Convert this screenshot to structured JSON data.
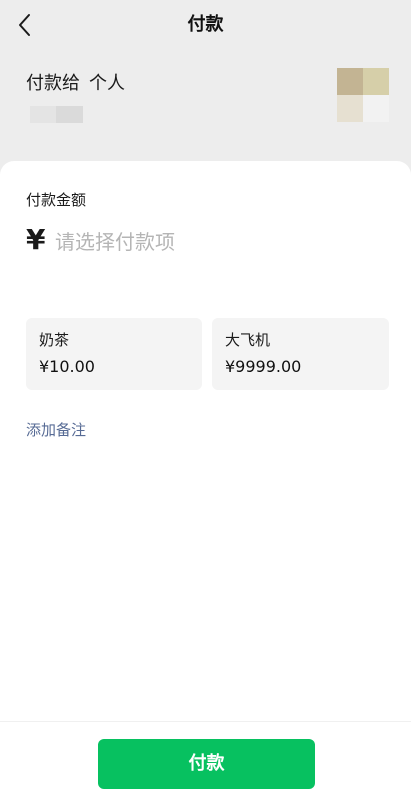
{
  "header": {
    "title": "付款",
    "back_icon": "chevron-left-icon"
  },
  "payee": {
    "prefix": "付款给",
    "name": "个人"
  },
  "amount": {
    "label": "付款金额",
    "currency": "¥",
    "placeholder": "请选择付款项",
    "value": ""
  },
  "options": [
    {
      "name": "奶茶",
      "price": "¥10.00"
    },
    {
      "name": "大飞机",
      "price": "¥9999.00"
    }
  ],
  "note_link": "添加备注",
  "pay_button": "付款",
  "colors": {
    "primary": "#07c160",
    "link": "#576b95",
    "page_bg": "#ededed",
    "card_bg": "#ffffff",
    "option_bg": "#f4f4f4",
    "placeholder": "#b5b5b5"
  }
}
